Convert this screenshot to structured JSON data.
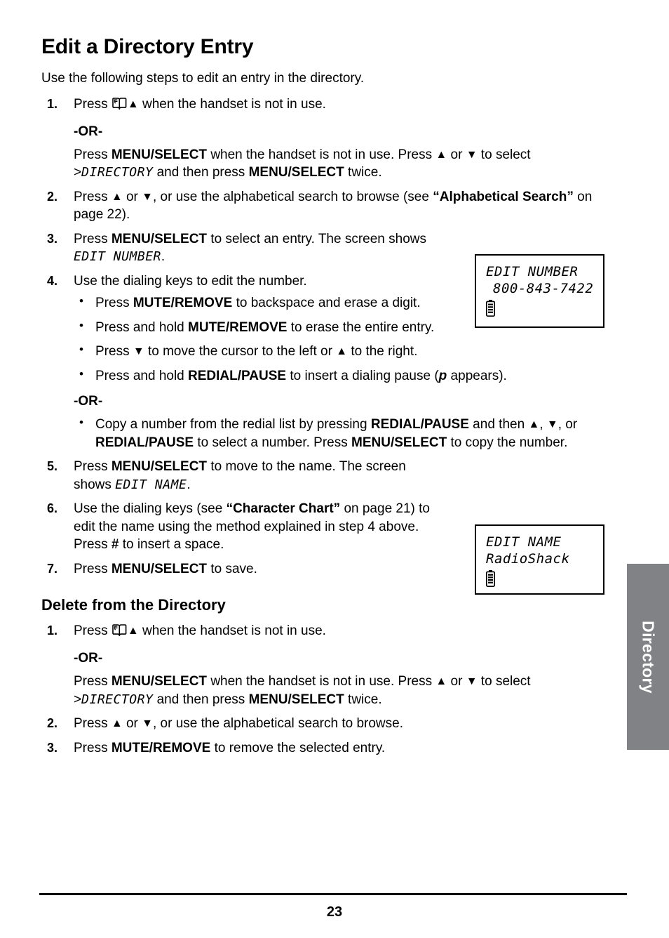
{
  "document": {
    "page_number": "23",
    "side_tab_label": "Directory"
  },
  "section_1": {
    "title": "Edit a Directory Entry",
    "intro": "Use the following steps to edit an entry in the directory.",
    "step1": {
      "number": "1.",
      "before_icons": "Press ",
      "icon_book": "book-icon",
      "icon_up": "▲",
      "after_icons": " when the handset is not in use."
    },
    "or_label": "-OR-",
    "step1_alt": {
      "t1": "Press ",
      "b1": "MENU/SELECT",
      "t2": " when the handset is not in use. Press ",
      "tri_up": "▲",
      "t3": " or ",
      "tri_down": "▼",
      "t4": " to select >",
      "lcd1": "DIRECTORY",
      "t5": " and then press ",
      "b2": "MENU/SELECT",
      "t6": " twice."
    },
    "step2": {
      "number": "2.",
      "t1": "Press ",
      "tri_up": "▲",
      "t2": " or ",
      "tri_down": "▼",
      "t3": ", or use the alphabetical search to browse (see ",
      "b1": "“Alphabetical Search”",
      "t4": " on page 22)."
    },
    "step3": {
      "number": "3.",
      "t1": "Press ",
      "b1": "MENU/SELECT",
      "t2": " to select an entry. The screen shows ",
      "lcd1": "EDIT NUMBER",
      "t3": "."
    },
    "step4": {
      "number": "4.",
      "text": "Use the dialing keys to edit the number.",
      "bullets": [
        {
          "t1": "Press ",
          "b1": "MUTE/REMOVE",
          "t2": " to backspace and erase a digit."
        },
        {
          "t1": "Press and hold ",
          "b1": "MUTE/REMOVE",
          "t2": " to erase the entire entry."
        },
        {
          "t1": "Press ",
          "tri_down": "▼",
          "t2": " to move the cursor to the left or ",
          "tri_up": "▲",
          "t3": " to the right."
        },
        {
          "t1": "Press and hold ",
          "b1": "REDIAL/PAUSE",
          "t2": " to insert a dialing pause (",
          "i1": "p",
          "t3": " appears)."
        }
      ],
      "or_label": "-OR-",
      "or_bullet": {
        "t1": "Copy a number from the redial list by pressing ",
        "b1": "REDIAL/PAUSE",
        "t2": " and then ",
        "tri_up": "▲",
        "t3": ", ",
        "tri_down": "▼",
        "t4": ", or ",
        "b2": "REDIAL/PAUSE",
        "t5": " to select a number. Press ",
        "b3": "MENU/SELECT",
        "t6": " to copy the number."
      }
    },
    "step5": {
      "number": "5.",
      "t1": "Press ",
      "b1": "MENU/SELECT",
      "t2": " to move to the name. The screen shows ",
      "lcd1": "EDIT NAME",
      "t3": "."
    },
    "step6": {
      "number": "6.",
      "t1": "Use the dialing keys (see ",
      "b1": "“Character Chart”",
      "t2": " on page 21) to edit the name using the method explained in step 4 above. Press ",
      "b2": "#",
      "t3": " to insert a space."
    },
    "step7": {
      "number": "7.",
      "t1": "Press ",
      "b1": "MENU/SELECT",
      "t2": " to save."
    }
  },
  "section_2": {
    "title": "Delete from the Directory",
    "step1": {
      "number": "1.",
      "before_icons": "Press ",
      "icon_book": "book-icon",
      "icon_up": "▲",
      "after_icons": " when the handset is not in use."
    },
    "or_label": "-OR-",
    "step1_alt": {
      "t1": "Press ",
      "b1": "MENU/SELECT",
      "t2": " when the handset is not in use. Press ",
      "tri_up": "▲",
      "t3": " or ",
      "tri_down": "▼",
      "t4": " to select >",
      "lcd1": "DIRECTORY",
      "t5": " and then press ",
      "b2": "MENU/SELECT",
      "t6": " twice."
    },
    "step2": {
      "number": "2.",
      "t1": "Press ",
      "tri_up": "▲",
      "t2": " or ",
      "tri_down": "▼",
      "t3": ", or use the alphabetical search to browse."
    },
    "step3": {
      "number": "3.",
      "t1": "Press ",
      "b1": "MUTE/REMOVE",
      "t2": " to remove the selected entry."
    }
  },
  "lcd_screens": [
    {
      "id": "edit-number-screen",
      "line1": "EDIT NUMBER",
      "line2": "800-843-7422",
      "status_icon": "battery-icon"
    },
    {
      "id": "edit-name-screen",
      "line1": "EDIT NAME",
      "line2": "RadioShack",
      "status_icon": "battery-icon"
    }
  ],
  "colors": {
    "side_tab_bg": "#808285",
    "text": "#000000",
    "page_bg": "#ffffff"
  }
}
